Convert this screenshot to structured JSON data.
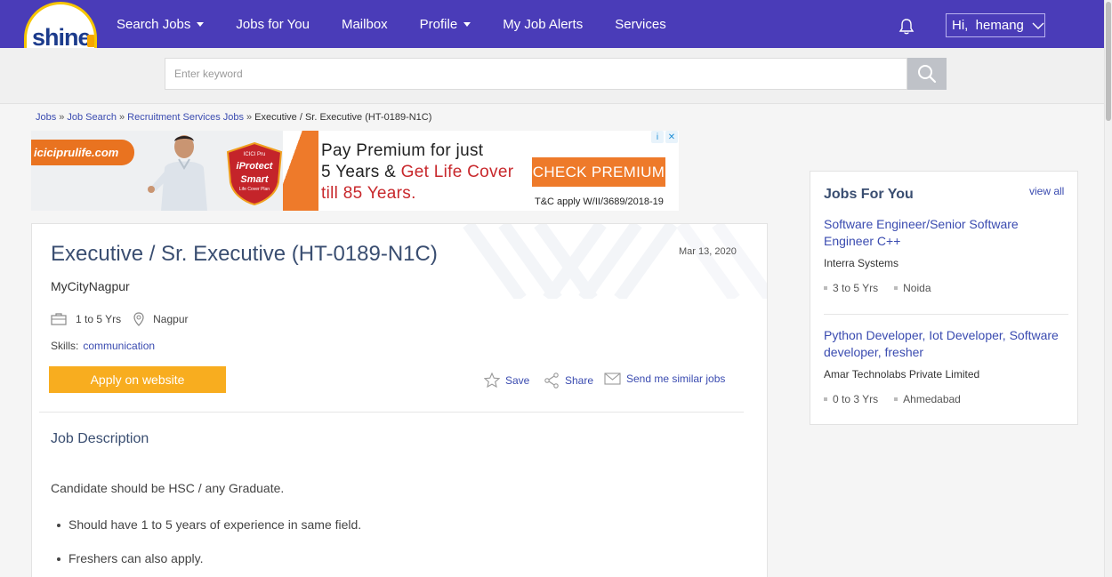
{
  "nav": {
    "logo_text": "shine",
    "logo_dot_text": ".com",
    "items": [
      {
        "label": "Search Jobs"
      },
      {
        "label": "Jobs for You"
      },
      {
        "label": "Mailbox"
      },
      {
        "label": "Profile"
      },
      {
        "label": "My Job Alerts"
      },
      {
        "label": "Services"
      }
    ],
    "user_greeting": "Hi,  hemang"
  },
  "search": {
    "placeholder": "Enter keyword"
  },
  "breadcrumb": {
    "items": [
      "Jobs",
      "Job Search",
      "Recruitment Services Jobs"
    ],
    "current": "Executive / Sr. Executive (HT-0189-N1C)",
    "separator": "»"
  },
  "ad": {
    "brand": "iciciprulife.com",
    "line1": "Pay Premium for just",
    "line2_a": "5 Years & ",
    "line2_b": "Get Life Cover",
    "line3": "till 85 Years.",
    "cta": "CHECK PREMIUM",
    "fine_print": "T&C apply W/II/3689/2018-19",
    "shield_top": "ICICI Pru",
    "shield_mid": "iProtect",
    "shield_bot": "Smart",
    "shield_tag": "Life Cover Plan"
  },
  "job": {
    "title": "Executive / Sr. Executive (HT-0189-N1C)",
    "date": "Mar 13, 2020",
    "company": "MyCityNagpur",
    "experience": "1 to 5 Yrs",
    "location": "Nagpur",
    "skills_label": "Skills:",
    "skills": [
      "communication"
    ],
    "apply_label": "Apply on website",
    "save_label": "Save",
    "share_label": "Share",
    "similar_label": "Send me similar jobs",
    "description_title": "Job Description",
    "description_intro": "Candidate should be HSC / any Graduate.",
    "bullets": [
      "Should have 1 to 5 years of experience in same field.",
      "Freshers can also apply."
    ]
  },
  "jobs_for_you": {
    "title": "Jobs For You",
    "view_all": "view all",
    "items": [
      {
        "title": "Software Engineer/Senior Software Engineer C++",
        "company": "Interra Systems",
        "experience": "3 to 5 Yrs",
        "location": "Noida"
      },
      {
        "title": "Python Developer, Iot Developer, Software developer, fresher",
        "company": "Amar Technolabs Private Limited",
        "experience": "0 to 3 Yrs",
        "location": "Ahmedabad"
      }
    ]
  }
}
